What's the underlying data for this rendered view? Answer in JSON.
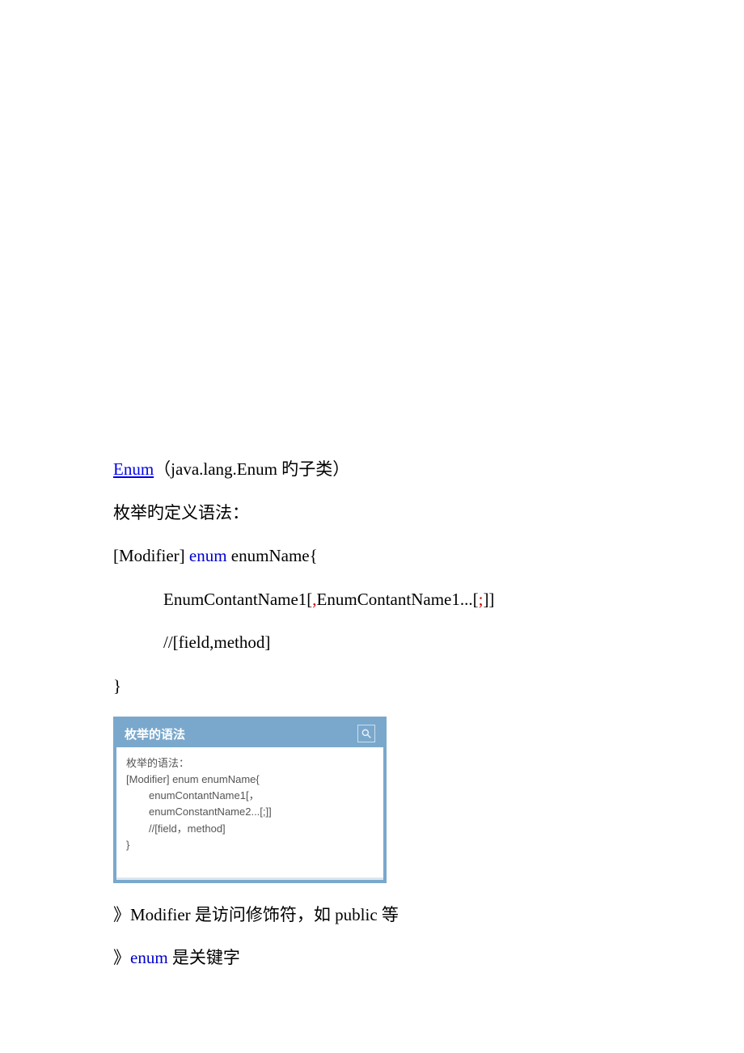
{
  "doc": {
    "line1_link": "Enum",
    "line1_rest": "（java.lang.Enum 旳子类）",
    "line2": "枚举旳定义语法：",
    "syntax": {
      "l1_a": "[Modifier] ",
      "l1_kw": "enum",
      "l1_b": " enumName{",
      "l2_a": "EnumContantName1[",
      "l2_comma": ",",
      "l2_b": "EnumContantName1...[",
      "l2_semi": ";",
      "l2_c": "]]",
      "l3": "//[field,method]",
      "l4": "}"
    },
    "slide": {
      "title": "枚举的语法",
      "b1": "枚举的语法：",
      "b2": "[Modifier] enum enumName{",
      "b3": "enumContantName1[，",
      "b4": "enumConstantName2...[;]]",
      "b5": "//[field，method]",
      "b6": "}"
    },
    "note1_a": "》Modifier  是访问修饰符，如 public 等",
    "note2_a": "》",
    "note2_kw": "enum",
    "note2_b": " 是关键字"
  }
}
